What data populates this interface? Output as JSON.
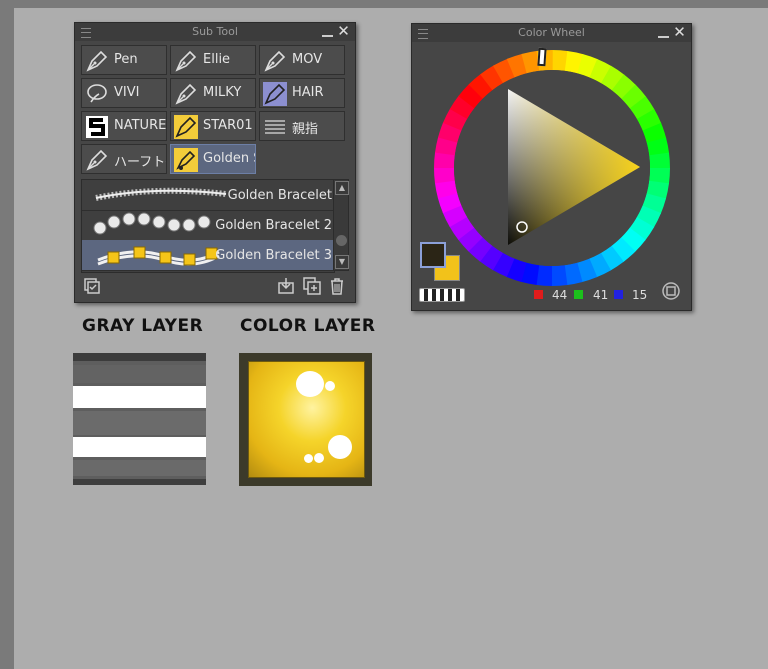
{
  "subtool": {
    "title": "Sub Tool",
    "tools": [
      {
        "label": "Pen",
        "icon": "pen-nib-icon",
        "selected": false
      },
      {
        "label": "Ellie",
        "icon": "pen-nib-icon",
        "selected": false
      },
      {
        "label": "MOV",
        "icon": "pen-nib-icon",
        "selected": false
      },
      {
        "label": "VIVI",
        "icon": "leaf-brush-icon",
        "selected": false
      },
      {
        "label": "MILKY",
        "icon": "pen-nib-icon",
        "selected": false
      },
      {
        "label": "HAIR",
        "icon": "pen-nib-icon",
        "selected": false
      },
      {
        "label": "NATURE",
        "icon": "s-block-icon",
        "selected": false
      },
      {
        "label": "STAR01",
        "icon": "pen-nib-icon",
        "selected": false
      },
      {
        "label": "親指",
        "icon": "lines-icon",
        "selected": false
      },
      {
        "label": "ハーフト～",
        "icon": "pen-nib-icon",
        "selected": false
      },
      {
        "label": "Golden S",
        "icon": "decoration-brush-icon",
        "selected": true
      }
    ],
    "brushes": [
      {
        "label": "Golden Bracelet",
        "selected": false
      },
      {
        "label": "Golden Bracelet 2",
        "selected": false
      },
      {
        "label": "Golden Bracelet 3",
        "selected": true
      }
    ]
  },
  "colorwheel": {
    "title": "Color Wheel",
    "main_color": "#2b2516",
    "sub_color": "#f2c21a",
    "r": "44",
    "g": "41",
    "b": "15"
  },
  "layers": {
    "gray_label": "GRAY LAYER",
    "color_label": "COLOR LAYER"
  }
}
